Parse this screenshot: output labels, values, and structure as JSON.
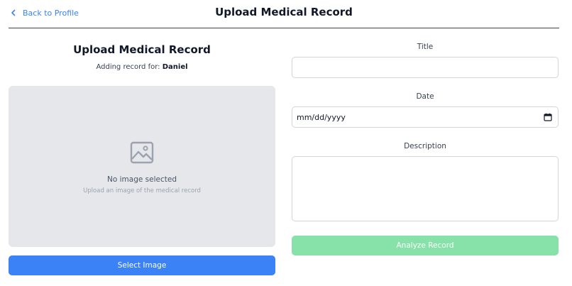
{
  "header": {
    "back_label": "Back to Profile",
    "title": "Upload Medical Record"
  },
  "left": {
    "title": "Upload Medical Record",
    "adding_for_prefix": "Adding record for:",
    "patient_name": "Daniel",
    "empty_title": "No image selected",
    "empty_hint": "Upload an image of the medical record",
    "select_button": "Select Image"
  },
  "form": {
    "title_label": "Title",
    "title_value": "",
    "date_label": "Date",
    "date_placeholder": "mm/dd/yyyy",
    "description_label": "Description",
    "description_value": "",
    "analyze_button": "Analyze Record"
  },
  "icons": {
    "back": "chevron-left-icon",
    "empty_image": "image-icon",
    "calendar": "calendar-icon"
  },
  "colors": {
    "primary": "#3b82f6",
    "analyze_disabled": "#86e2a8",
    "dropzone": "#e5e7eb"
  }
}
